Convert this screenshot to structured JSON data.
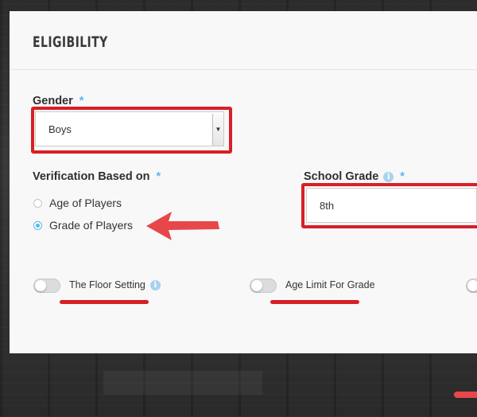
{
  "section": {
    "title": "ELIGIBILITY"
  },
  "gender": {
    "label": "Gender",
    "required_mark": "*",
    "value": "Boys"
  },
  "verification": {
    "label": "Verification Based on",
    "required_mark": "*",
    "options": [
      {
        "label": "Age of Players",
        "selected": false
      },
      {
        "label": "Grade of Players",
        "selected": true
      }
    ]
  },
  "school_grade": {
    "label": "School Grade",
    "required_mark": "*",
    "value": "8th",
    "info_glyph": "i"
  },
  "toggles": [
    {
      "label": "The Floor Setting",
      "on": false,
      "info_glyph": "i"
    },
    {
      "label": "Age Limit For Grade",
      "on": false
    }
  ],
  "annotation_colors": {
    "highlight": "#d81f26",
    "arrow": "#e8474a",
    "accent": "#5bb6e8"
  },
  "icons": {
    "caret": "caret-down-icon",
    "info": "info-icon",
    "arrow": "left-arrow-icon"
  }
}
